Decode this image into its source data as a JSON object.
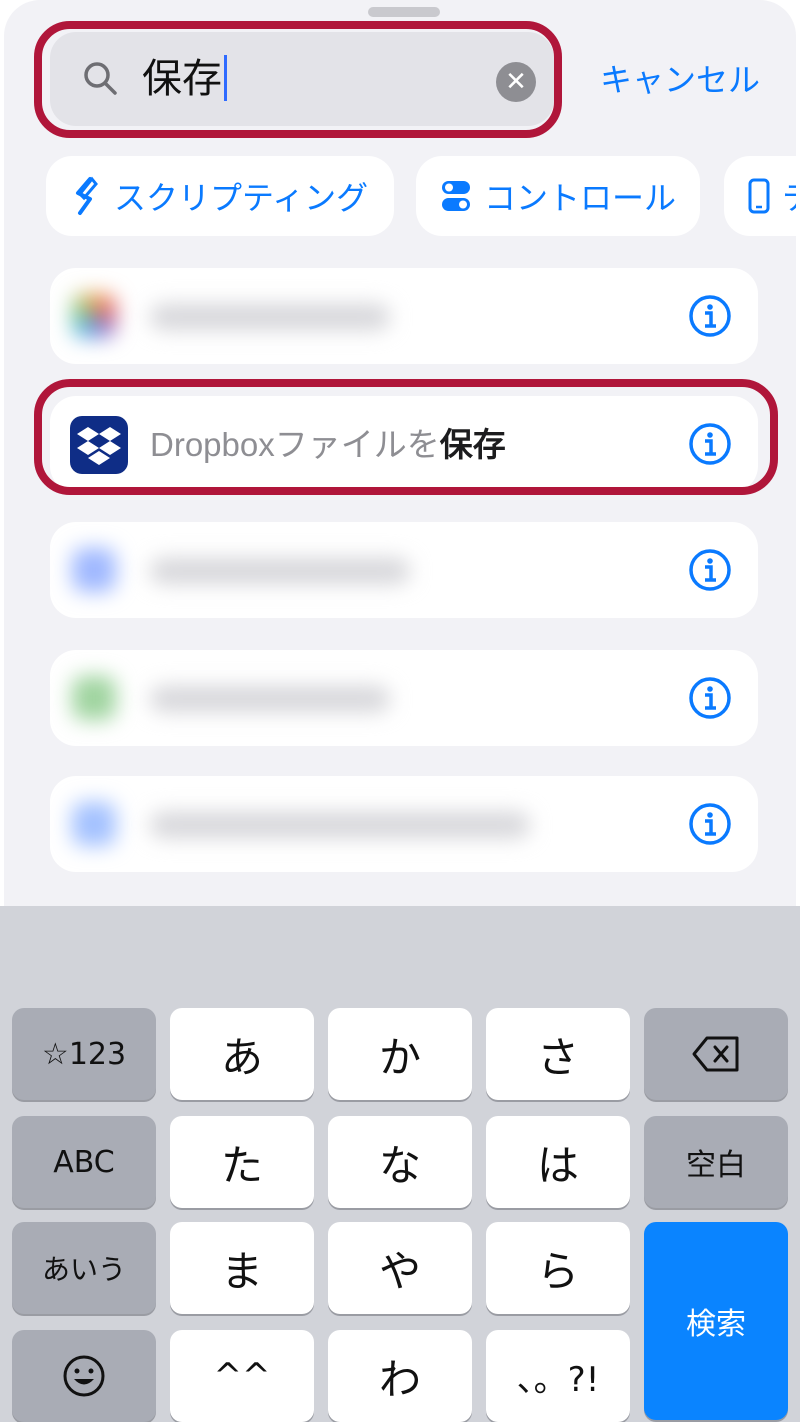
{
  "search": {
    "query": "保存",
    "cancel_label": "キャンセル"
  },
  "chips": [
    {
      "label": "スクリプティング",
      "icon": "scripting-icon"
    },
    {
      "label": "コントロール",
      "icon": "toggle-icon"
    },
    {
      "label": "テ",
      "icon": "phone-icon"
    }
  ],
  "results": {
    "highlight": {
      "app_label": "Dropbox",
      "prefix": "ファイルを",
      "match": "保存",
      "icon": "dropbox-icon"
    }
  },
  "keyboard": {
    "row1": [
      "☆123",
      "あ",
      "か",
      "さ",
      "⌫"
    ],
    "row2": [
      "ABC",
      "た",
      "な",
      "は",
      "空白"
    ],
    "row3": [
      "あいう",
      "ま",
      "や",
      "ら"
    ],
    "row4": [
      "☺",
      "^^",
      "わ",
      "、。?!"
    ],
    "enter_label": "検索"
  },
  "colors": {
    "accent": "#0a7aff",
    "highlight": "#b0163a",
    "dropbox": "#0f2d86"
  }
}
